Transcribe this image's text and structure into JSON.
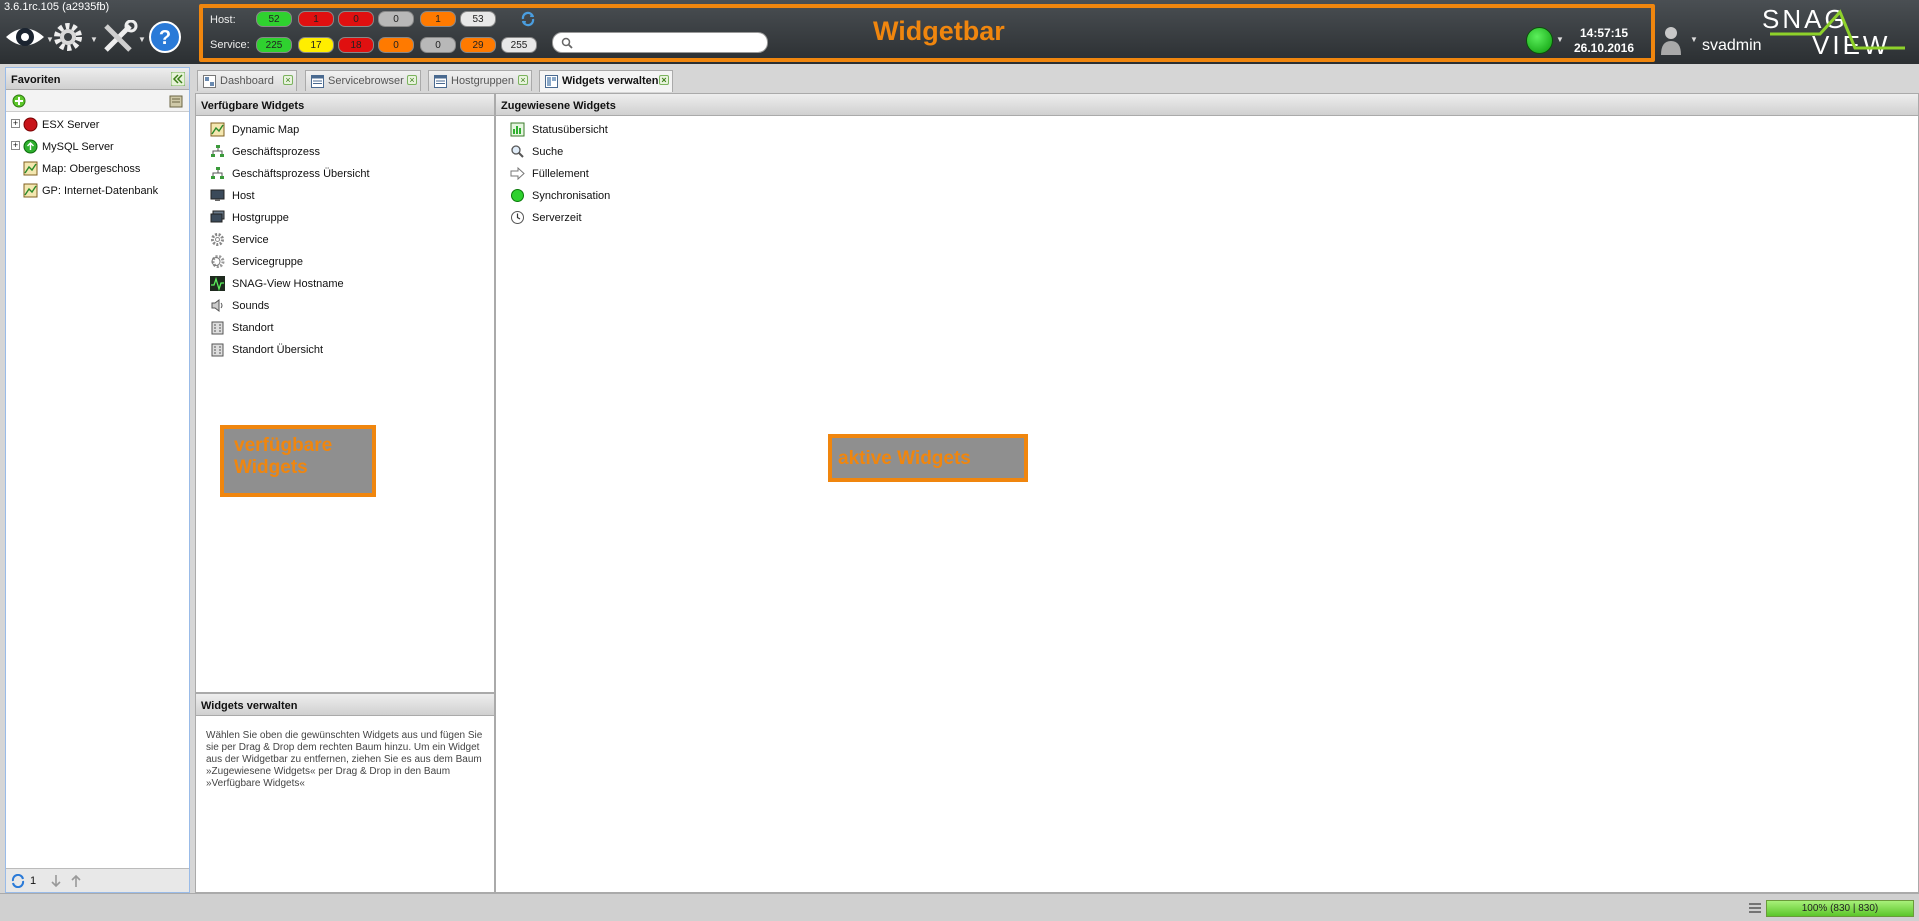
{
  "app": {
    "version": "3.6.1rc.105 (a2935fb)"
  },
  "widgetbar": {
    "title": "Widgetbar",
    "host_label": "Host:",
    "service_label": "Service:",
    "host_counts": [
      {
        "value": "52",
        "color": "#2fd12f"
      },
      {
        "value": "1",
        "color": "#e01010"
      },
      {
        "value": "0",
        "color": "#e01010"
      },
      {
        "value": "0",
        "color": "#b8b8b8"
      },
      {
        "value": "1",
        "color": "#ff7a00"
      },
      {
        "value": "53",
        "color": "#e8e8e8"
      }
    ],
    "service_counts": [
      {
        "value": "225",
        "color": "#2fd12f"
      },
      {
        "value": "17",
        "color": "#ffee00"
      },
      {
        "value": "18",
        "color": "#e01010"
      },
      {
        "value": "0",
        "color": "#ff7a00"
      },
      {
        "value": "0",
        "color": "#b8b8b8"
      },
      {
        "value": "29",
        "color": "#ff7a00"
      },
      {
        "value": "255",
        "color": "#e8e8e8"
      }
    ],
    "search_placeholder": "",
    "time": "14:57:15",
    "date": "26.10.2016",
    "username": "svadmin",
    "logo_text_top": "SNAG",
    "logo_text_bottom": "VIEW"
  },
  "favorites": {
    "title": "Favoriten",
    "items": [
      {
        "label": "ESX Server",
        "icon": "red-status-icon",
        "expandable": true
      },
      {
        "label": "MySQL Server",
        "icon": "green-status-icon",
        "expandable": true
      },
      {
        "label": "Map: Obergeschoss",
        "icon": "map-icon",
        "expandable": false
      },
      {
        "label": "GP: Internet-Datenbank",
        "icon": "map-icon",
        "expandable": false
      }
    ],
    "footer_count": "1"
  },
  "tabs": [
    {
      "label": "Dashboard",
      "icon": "dashboard-icon",
      "active": false
    },
    {
      "label": "Servicebrowser",
      "icon": "browser-icon",
      "active": false
    },
    {
      "label": "Hostgruppen",
      "icon": "browser-icon",
      "active": false
    },
    {
      "label": "Widgets verwalten",
      "icon": "widgets-icon",
      "active": true
    }
  ],
  "available": {
    "title": "Verfügbare Widgets",
    "items": [
      {
        "label": "Dynamic Map",
        "icon": "map-icon"
      },
      {
        "label": "Geschäftsprozess",
        "icon": "process-icon"
      },
      {
        "label": "Geschäftsprozess Übersicht",
        "icon": "process-icon"
      },
      {
        "label": "Host",
        "icon": "host-icon"
      },
      {
        "label": "Hostgruppe",
        "icon": "hostgroup-icon"
      },
      {
        "label": "Service",
        "icon": "service-gear-icon"
      },
      {
        "label": "Servicegruppe",
        "icon": "servicegroup-gear-icon"
      },
      {
        "label": "SNAG-View Hostname",
        "icon": "pulse-icon"
      },
      {
        "label": "Sounds",
        "icon": "speaker-icon"
      },
      {
        "label": "Standort",
        "icon": "building-icon"
      },
      {
        "label": "Standort Übersicht",
        "icon": "building-icon"
      }
    ],
    "overlay_label": "verfügbare Widgets"
  },
  "assigned": {
    "title": "Zugewiesene Widgets",
    "items": [
      {
        "label": "Statusübersicht",
        "icon": "status-overview-icon"
      },
      {
        "label": "Suche",
        "icon": "magnifier-icon"
      },
      {
        "label": "Füllelement",
        "icon": "arrow-icon"
      },
      {
        "label": "Synchronisation",
        "icon": "green-dot-icon"
      },
      {
        "label": "Serverzeit",
        "icon": "clock-icon"
      }
    ],
    "overlay_label": "aktive Widgets"
  },
  "help": {
    "title": "Widgets verwalten",
    "text": "Wählen Sie oben die gewünschten Widgets aus und fügen Sie sie per Drag & Drop dem rechten Baum hinzu. Um ein Widget aus der Widgetbar zu entfernen, ziehen Sie es aus dem Baum »Zugewiesene Widgets« per Drag & Drop in den Baum »Verfügbare Widgets«"
  },
  "statusbar": {
    "progress_text": "100% (830 | 830)",
    "progress": 1.0
  }
}
